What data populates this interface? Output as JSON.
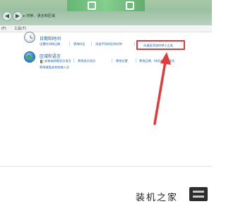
{
  "breadcrumb": {
    "items": [
      "时钟、语言和区域"
    ],
    "separator": "▸"
  },
  "menubar": {
    "items": [
      "(F)",
      "工具(T)"
    ]
  },
  "categories": [
    {
      "title": "日期和时间",
      "icon": "clock-icon",
      "links": [
        "设置时间和日期",
        "更改时区",
        "添加不同时区的时钟"
      ],
      "highlighted_link": "向桌面添加时钟小工具"
    },
    {
      "title": "区域和语言",
      "icon": "globe-icon",
      "links": [
        "安装或卸载显示语言",
        "更改显示语言",
        "更改位置",
        "更改日期、时间或数字格式",
        "更改键盘或其他输入法"
      ]
    }
  ],
  "watermark": "装机之家",
  "colors": {
    "link": "#1c5fa3",
    "highlight": "#e23b3b",
    "topbar": "#a6c8a6"
  }
}
